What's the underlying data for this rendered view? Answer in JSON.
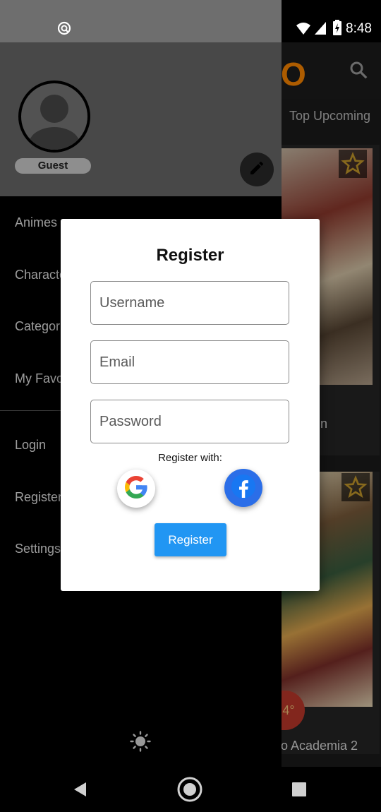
{
  "status_bar": {
    "time": "8:48"
  },
  "app": {
    "logo_glyph": "O",
    "tab_label": "Top Upcoming",
    "card2_title": "o Academia 2",
    "card1_title_fragment": "n",
    "rating_fragment": "4°"
  },
  "drawer": {
    "user_label": "Guest",
    "menu": {
      "animes": "Animes",
      "characters": "Characte",
      "categories": "Categorie",
      "favorites": "My Favor",
      "login": "Login",
      "register": "Register",
      "settings": "Settings"
    }
  },
  "dialog": {
    "title": "Register",
    "username_placeholder": "Username",
    "email_placeholder": "Email",
    "password_placeholder": "Password",
    "register_with": "Register with:",
    "register_button": "Register"
  },
  "colors": {
    "accent_blue": "#2196f3",
    "facebook_blue": "#2b6ee8",
    "logo_orange": "#ff8800",
    "rating_red": "#c0392b"
  },
  "icons": [
    "wifi-icon",
    "cell-signal-icon",
    "battery-icon",
    "search-icon",
    "star-icon",
    "edit-icon",
    "sun-icon",
    "google-icon",
    "facebook-icon",
    "back-icon",
    "home-icon",
    "recents-icon"
  ]
}
